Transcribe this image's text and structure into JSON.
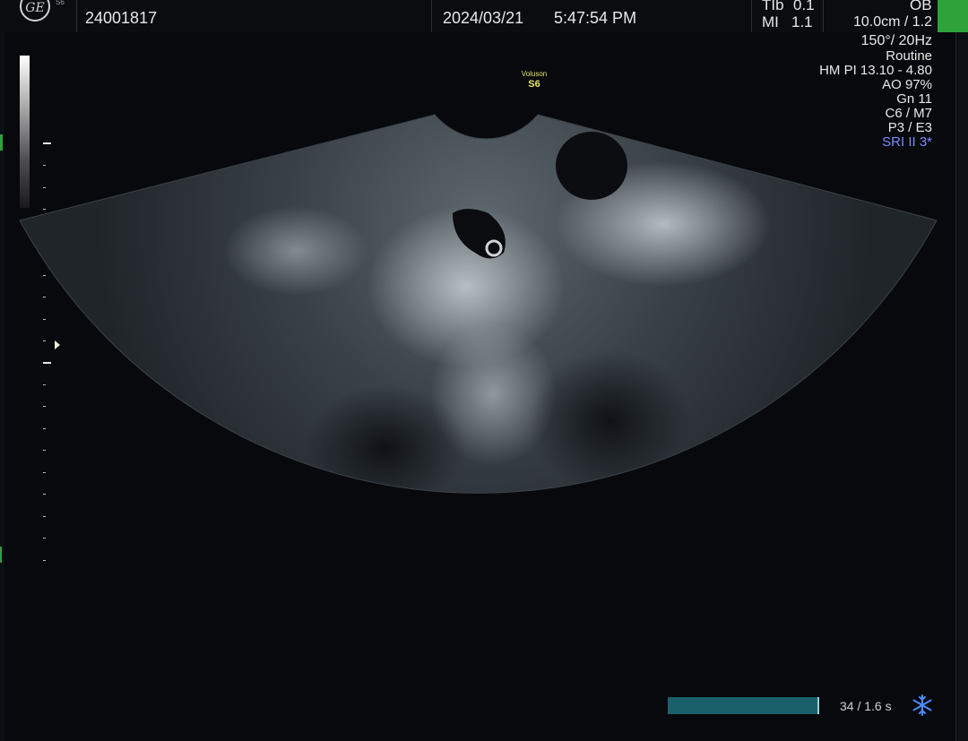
{
  "header": {
    "logo_text": "GE",
    "logo_sub": "S6",
    "patient_id": "24001817",
    "date": "2024/03/21",
    "time": "5:47:54 PM",
    "tib_label": "TIb",
    "tib_value": "0.1",
    "mi_label": "MI",
    "mi_value": "1.1",
    "application": "OB"
  },
  "params": {
    "depth": "10.0cm / 1.2",
    "angle_rate": "150°/ 20Hz",
    "preset": "Routine",
    "harmonic": "HM PI 13.10 - 4.80",
    "ao": "AO 97%",
    "gain": "Gn  11",
    "c_m": "C6 / M7",
    "p_e": "P3 / E3",
    "sri": "SRI II 3*"
  },
  "brand": {
    "name": "Voluson",
    "model": "S6"
  },
  "cine": {
    "counter": "34 / 1.6 s",
    "progress": 1.0
  },
  "icons": {
    "freeze": "snowflake-icon",
    "logo": "ge-logo-icon"
  },
  "colors": {
    "accent_green": "#2fa23a",
    "cine_bar": "#19606a",
    "sri_blue": "#7f8cff",
    "brand_yellow": "#e3e36a"
  }
}
